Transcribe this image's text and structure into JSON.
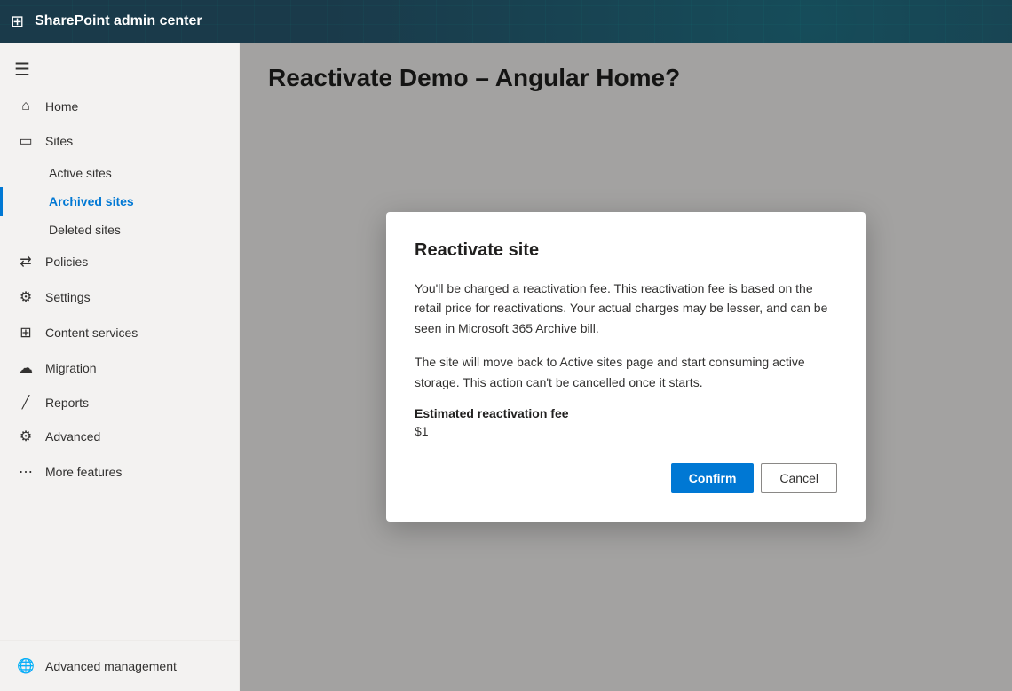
{
  "header": {
    "waffle_icon": "⊞",
    "app_title": "SharePoint admin center"
  },
  "sidebar": {
    "hamburger_icon": "☰",
    "nav_items": [
      {
        "id": "home",
        "label": "Home",
        "icon": "⌂"
      },
      {
        "id": "sites",
        "label": "Sites",
        "icon": "▭",
        "children": [
          {
            "id": "active-sites",
            "label": "Active sites",
            "active": false
          },
          {
            "id": "archived-sites",
            "label": "Archived sites",
            "active": true
          },
          {
            "id": "deleted-sites",
            "label": "Deleted sites",
            "active": false
          }
        ]
      },
      {
        "id": "policies",
        "label": "Policies",
        "icon": "⇄"
      },
      {
        "id": "settings",
        "label": "Settings",
        "icon": "⚙"
      },
      {
        "id": "content-services",
        "label": "Content services",
        "icon": "⊞"
      },
      {
        "id": "migration",
        "label": "Migration",
        "icon": "☁"
      },
      {
        "id": "reports",
        "label": "Reports",
        "icon": "📈"
      },
      {
        "id": "advanced",
        "label": "Advanced",
        "icon": "⚙"
      },
      {
        "id": "more-features",
        "label": "More features",
        "icon": "⋯"
      }
    ],
    "bottom_item": {
      "id": "advanced-management",
      "label": "Advanced management",
      "icon": "🌐"
    }
  },
  "main": {
    "page_title": "Reactivate Demo – Angular Home?"
  },
  "dialog": {
    "title": "Reactivate site",
    "body_paragraph_1": "You'll be charged a reactivation fee. This reactivation fee is based on the retail price for reactivations. Your actual charges may be lesser, and can be seen in Microsoft 365 Archive bill.",
    "body_paragraph_2": "The site will move back to Active sites page and start consuming active storage. This action can't be cancelled once it starts.",
    "fee_label": "Estimated reactivation fee",
    "fee_value": "$1",
    "confirm_label": "Confirm",
    "cancel_label": "Cancel"
  }
}
